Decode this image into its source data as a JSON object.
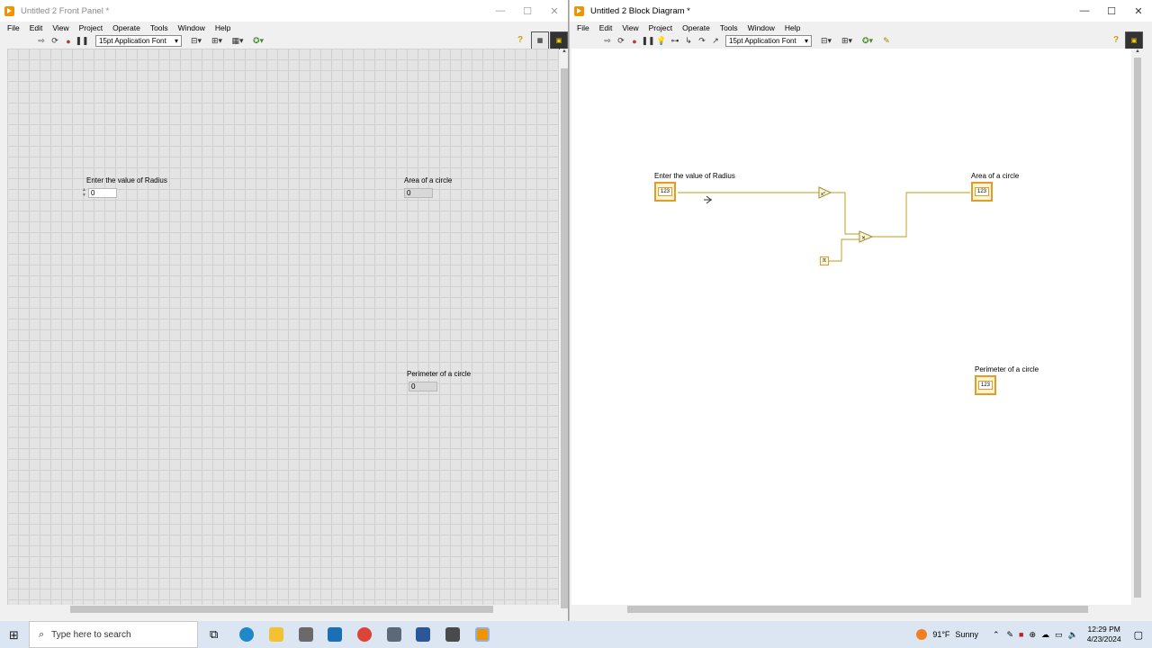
{
  "front_panel": {
    "title": "Untitled 2 Front Panel *",
    "menu": [
      "File",
      "Edit",
      "View",
      "Project",
      "Operate",
      "Tools",
      "Window",
      "Help"
    ],
    "font_select": "15pt Application Font",
    "controls": {
      "radius_label": "Enter the value of Radius",
      "radius_value": "0",
      "area_label": "Area of a circle",
      "area_value": "0",
      "perimeter_label": "Perimeter of a circle",
      "perimeter_value": "0"
    }
  },
  "block_diagram": {
    "title": "Untitled 2 Block Diagram *",
    "menu": [
      "File",
      "Edit",
      "View",
      "Project",
      "Operate",
      "Tools",
      "Window",
      "Help"
    ],
    "font_select": "15pt Application Font",
    "terminals": {
      "radius_label": "Enter the value of Radius",
      "radius_type": "123",
      "area_label": "Area of a circle",
      "area_type": "123",
      "perimeter_label": "Perimeter of a circle",
      "perimeter_type": "123",
      "pi_const": "π"
    },
    "wire_color": "#c8b24a"
  },
  "window_buttons": {
    "minimize": "—",
    "maximize": "☐",
    "close": "✕"
  },
  "taskbar": {
    "search_placeholder": "Type here to search",
    "weather_temp": "91°F",
    "weather_desc": "Sunny",
    "time": "12:29 PM",
    "date": "4/23/2024"
  }
}
